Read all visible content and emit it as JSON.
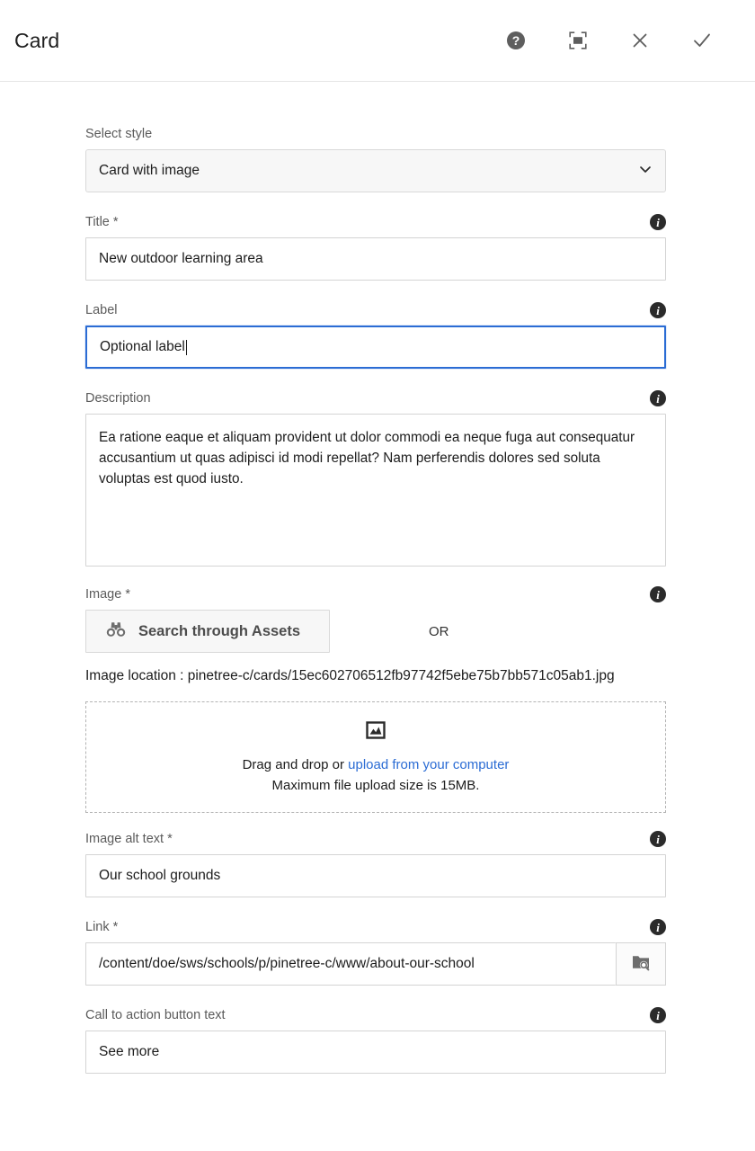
{
  "header": {
    "title": "Card",
    "actions": [
      {
        "name": "help-icon",
        "label": "Help"
      },
      {
        "name": "fullscreen-icon",
        "label": "Fullscreen"
      },
      {
        "name": "close-icon",
        "label": "Close"
      },
      {
        "name": "confirm-check-icon",
        "label": "Done"
      }
    ]
  },
  "form": {
    "select_style": {
      "label": "Select style",
      "value": "Card with image",
      "options": [
        "Card with image"
      ]
    },
    "title": {
      "label": "Title *",
      "value": "New outdoor learning area",
      "info": "i"
    },
    "card_label": {
      "label": "Label",
      "value": "Optional label",
      "focused": true,
      "info": "i"
    },
    "description": {
      "label": "Description",
      "value": "Ea ratione eaque et aliquam provident ut dolor commodi ea neque fuga aut consequatur accusantium ut quas adipisci id modi repellat? Nam perferendis dolores sed soluta voluptas est quod iusto.",
      "info": "i"
    },
    "image": {
      "label": "Image *",
      "search_button": "Search through Assets",
      "or": "OR",
      "location": "Image location : pinetree-c/cards/15ec602706512fb97742f5ebe75b7bb571c05ab1.jpg",
      "dropzone": {
        "line1_prefix": "Drag and drop or ",
        "line1_link": "upload from your computer",
        "line2": "Maximum file upload size is 15MB."
      },
      "info": "i"
    },
    "image_alt": {
      "label": "Image alt text *",
      "value": "Our school grounds",
      "info": "i"
    },
    "link": {
      "label": "Link *",
      "value": "/content/doe/sws/schools/p/pinetree-c/www/about-our-school",
      "info": "i"
    },
    "cta": {
      "label": "Call to action button text",
      "value": "See more",
      "info": "i"
    }
  },
  "colors": {
    "accent_blue": "#2b6cd4",
    "icon_dark": "#2b2b2b",
    "border": "#d4d4d4",
    "label_gray": "#5b5b5b"
  }
}
